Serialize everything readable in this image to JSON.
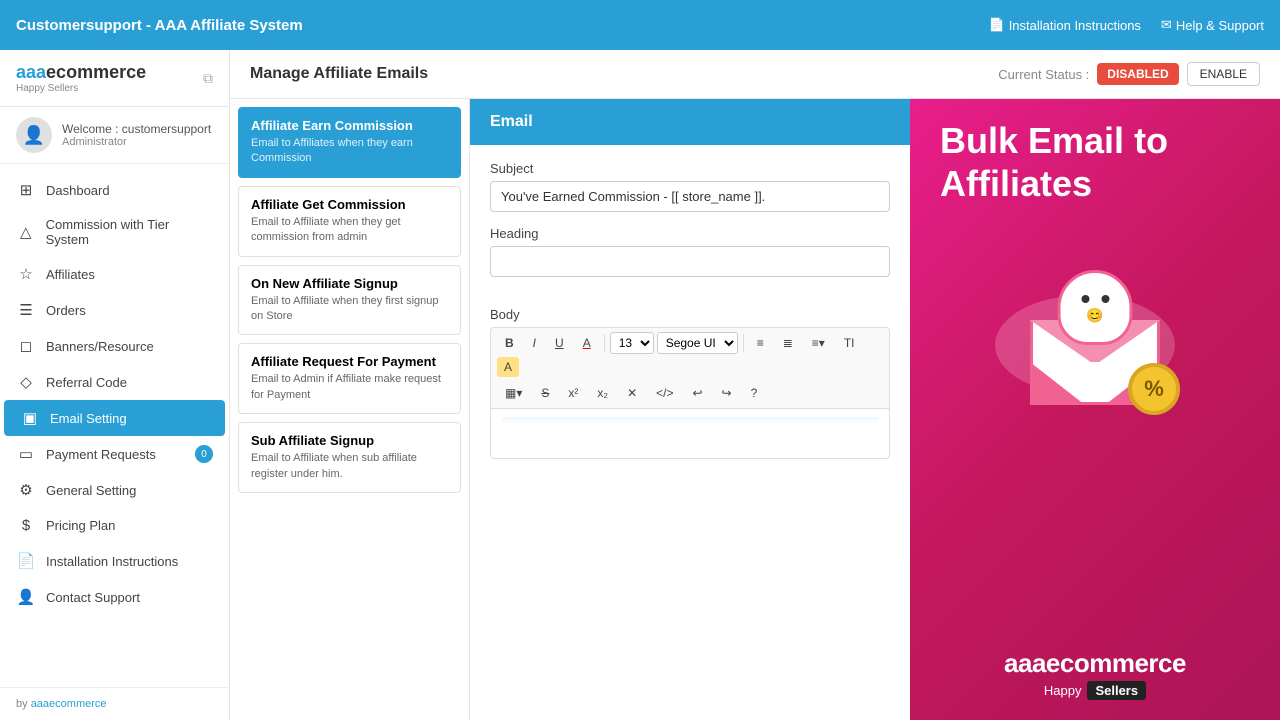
{
  "topNav": {
    "title": "Customersupport - AAA Affiliate System",
    "links": [
      {
        "id": "installation",
        "icon": "📄",
        "label": "Installation Instructions"
      },
      {
        "id": "help",
        "icon": "✉",
        "label": "Help & Support"
      }
    ]
  },
  "sidebar": {
    "logo": {
      "brand": "aaaecommerce",
      "sub": "Happy Sellers"
    },
    "user": {
      "welcome": "Welcome : customersupport",
      "role": "Administrator"
    },
    "items": [
      {
        "id": "dashboard",
        "icon": "⊞",
        "label": "Dashboard",
        "active": false,
        "badge": null
      },
      {
        "id": "commission",
        "icon": "△",
        "label": "Commission with Tier System",
        "active": false,
        "badge": null
      },
      {
        "id": "affiliates",
        "icon": "☆",
        "label": "Affiliates",
        "active": false,
        "badge": null
      },
      {
        "id": "orders",
        "icon": "☰",
        "label": "Orders",
        "active": false,
        "badge": null
      },
      {
        "id": "banners",
        "icon": "◻",
        "label": "Banners/Resource",
        "active": false,
        "badge": null
      },
      {
        "id": "referral",
        "icon": "◇",
        "label": "Referral Code",
        "active": false,
        "badge": null
      },
      {
        "id": "email",
        "icon": "▣",
        "label": "Email Setting",
        "active": true,
        "badge": null
      },
      {
        "id": "payment",
        "icon": "▭",
        "label": "Payment Requests",
        "active": false,
        "badge": "0"
      },
      {
        "id": "general",
        "icon": "⚙",
        "label": "General Setting",
        "active": false,
        "badge": null
      },
      {
        "id": "pricing",
        "icon": "$",
        "label": "Pricing Plan",
        "active": false,
        "badge": null
      },
      {
        "id": "installation",
        "icon": "📄",
        "label": "Installation Instructions",
        "active": false,
        "badge": null
      },
      {
        "id": "support",
        "icon": "👤",
        "label": "Contact Support",
        "active": false,
        "badge": null
      }
    ],
    "footer": {
      "prefix": "by",
      "link": "aaaecommerce"
    }
  },
  "page": {
    "title": "Manage Affiliate Emails",
    "statusLabel": "Current Status :",
    "statusValue": "DISABLED",
    "enableButton": "ENABLE"
  },
  "emailCards": [
    {
      "id": "earn",
      "title": "Affiliate Earn Commission",
      "desc": "Email to Affiliates when they earn Commission",
      "active": true
    },
    {
      "id": "get",
      "title": "Affiliate Get Commission",
      "desc": "Email to Affiliate when they get commission from admin",
      "active": false
    },
    {
      "id": "signup",
      "title": "On New Affiliate Signup",
      "desc": "Email to Affiliate when they first signup on Store",
      "active": false
    },
    {
      "id": "payment",
      "title": "Affiliate Request For Payment",
      "desc": "Email to Admin if Affiliate make request for Payment",
      "active": false
    },
    {
      "id": "subaffiliate",
      "title": "Sub Affiliate Signup",
      "desc": "Email to Affiliate when sub affiliate register under him.",
      "active": false
    }
  ],
  "emailEditor": {
    "header": "Email",
    "subjectLabel": "Subject",
    "subjectValue": "You've Earned Commission - [[ store_name ]].",
    "headingLabel": "Heading",
    "headingValue": "",
    "bodyLabel": "Body",
    "toolbar": {
      "bold": "B",
      "italic": "I",
      "underline": "U",
      "strikeFont": "S",
      "size": "13",
      "font": "Segoe UI",
      "bullet": "≡",
      "numbered": "≣",
      "align": "≡",
      "textDir": "TI",
      "highlight": "A",
      "table": "▦",
      "strikethrough": "S",
      "superscript": "x²",
      "subscript": "x₂",
      "removeFormat": "✕",
      "code": "</>",
      "undo": "↩",
      "redo": "↪",
      "help": "?"
    }
  },
  "promo": {
    "headline": "Bulk Email to\nAffiliates",
    "logoText": "aaaecommerce",
    "logoSub": "Happy",
    "sellers": "Sellers"
  }
}
